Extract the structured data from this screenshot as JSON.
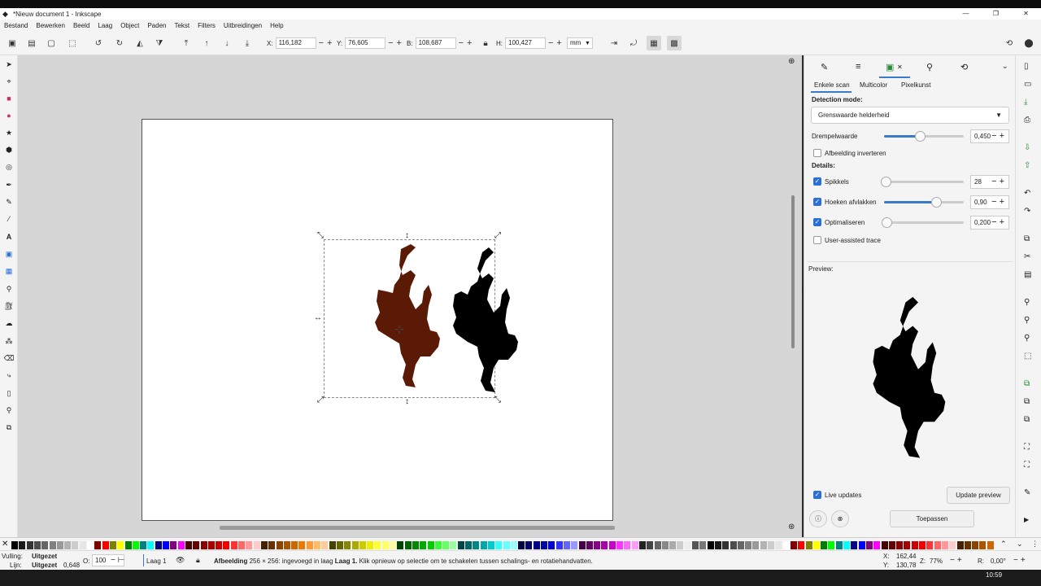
{
  "titlebar": {
    "title": "*Nieuw document 1 - Inkscape"
  },
  "menu": [
    "Bestand",
    "Bewerken",
    "Beeld",
    "Laag",
    "Object",
    "Paden",
    "Tekst",
    "Filters",
    "Uitbreidingen",
    "Help"
  ],
  "toolcontrols": {
    "x_label": "X:",
    "x_value": "116,182",
    "y_label": "Y:",
    "y_value": "76,605",
    "w_label": "B:",
    "w_value": "108,687",
    "h_label": "H:",
    "h_value": "100,427",
    "unit": "mm"
  },
  "dock": {
    "subtabs": [
      "Enkele scan",
      "Multicolor",
      "Pixelkunst"
    ],
    "detection_mode_label": "Detection mode:",
    "detection_mode_value": "Grenswaarde helderheid",
    "threshold_label": "Drempelwaarde",
    "threshold_value": "0,450",
    "threshold_level": 0.45,
    "invert_label": "Afbeelding inverteren",
    "details_label": "Details:",
    "speckles_label": "Spikkels",
    "speckles_value": "28",
    "smooth_label": "Hoeken afvlakken",
    "smooth_value": "0,90",
    "smooth_level": 0.65,
    "optimize_label": "Optimaliseren",
    "optimize_value": "0,200",
    "user_assisted_label": "User-assisted trace",
    "preview_label": "Preview:",
    "live_updates_label": "Live updates",
    "update_preview_label": "Update preview",
    "apply_label": "Toepassen"
  },
  "status": {
    "fill_label": "Vulling:",
    "fill_value": "Uitgezet",
    "stroke_label": "Lijn:",
    "stroke_value": "Uitgezet",
    "stroke_width": "0,648",
    "opacity_label": "O:",
    "opacity_value": "100",
    "layer_name": "Laag 1",
    "message_bold": "Afbeelding",
    "message_mid": "256 × 256: ingevoegd in laag",
    "message_layer": "Laag 1.",
    "message_rest": "Klik opnieuw op selectie om te schakelen tussen schalings- en rotatiehandvatten.",
    "cursor_x_label": "X:",
    "cursor_x": "162,44",
    "cursor_y_label": "Y:",
    "cursor_y": "130,78",
    "zoom_label": "Z:",
    "zoom_value": "77%",
    "rotation_label": "R:",
    "rotation_value": "0,00°"
  },
  "taskbar": {
    "clock": "10:59"
  },
  "colors": {
    "accent": "#3b7ac9",
    "silhouette_brown": "#5a1a05",
    "silhouette_black": "#000000"
  }
}
